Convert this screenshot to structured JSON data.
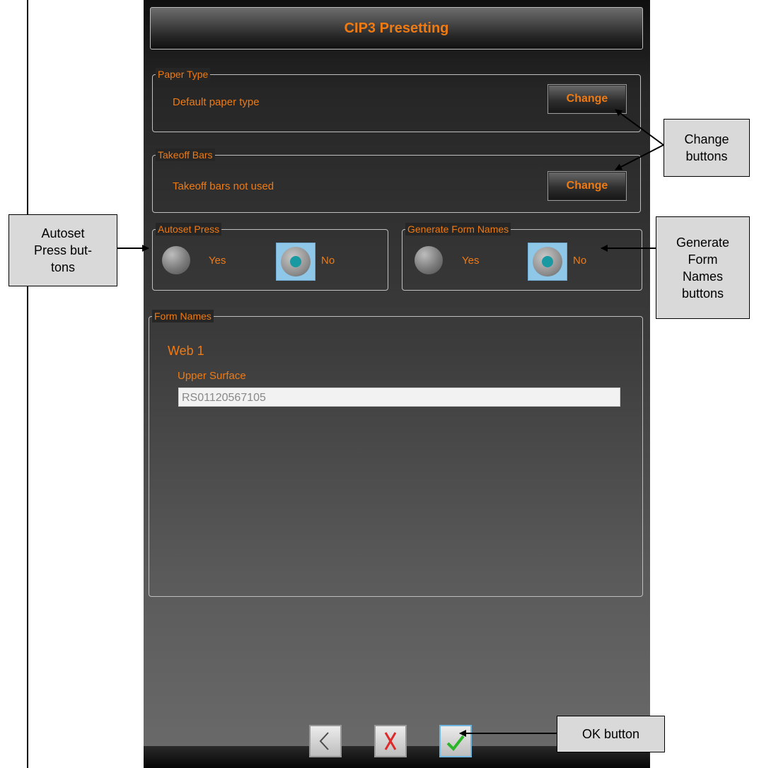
{
  "title": "CIP3 Presetting",
  "paper_type": {
    "legend": "Paper Type",
    "value": "Default paper type",
    "button": "Change"
  },
  "takeoff_bars": {
    "legend": "Takeoff Bars",
    "value": "Takeoff bars not used",
    "button": "Change"
  },
  "autoset_press": {
    "legend": "Autoset Press",
    "yes": "Yes",
    "no": "No",
    "selected": "No"
  },
  "generate_form_names": {
    "legend": "Generate Form Names",
    "yes": "Yes",
    "no": "No",
    "selected": "No"
  },
  "form_names": {
    "legend": "Form Names",
    "web": "Web 1",
    "surface_label": "Upper Surface",
    "surface_value": "RS01120567105"
  },
  "nav": {
    "back_icon": "chevron-left-icon",
    "cancel_icon": "x-icon",
    "ok_icon": "checkmark-icon"
  },
  "callouts": {
    "change": [
      "Change",
      "buttons"
    ],
    "autoset": [
      "Autoset",
      "Press but-",
      "tons"
    ],
    "generate": [
      "Generate",
      "Form",
      "Names",
      "buttons"
    ],
    "ok": "OK button"
  },
  "colors": {
    "accent": "#f07a12",
    "radio_selected": "#199aa3",
    "cancel": "#e0282a",
    "ok": "#2ab52a"
  }
}
